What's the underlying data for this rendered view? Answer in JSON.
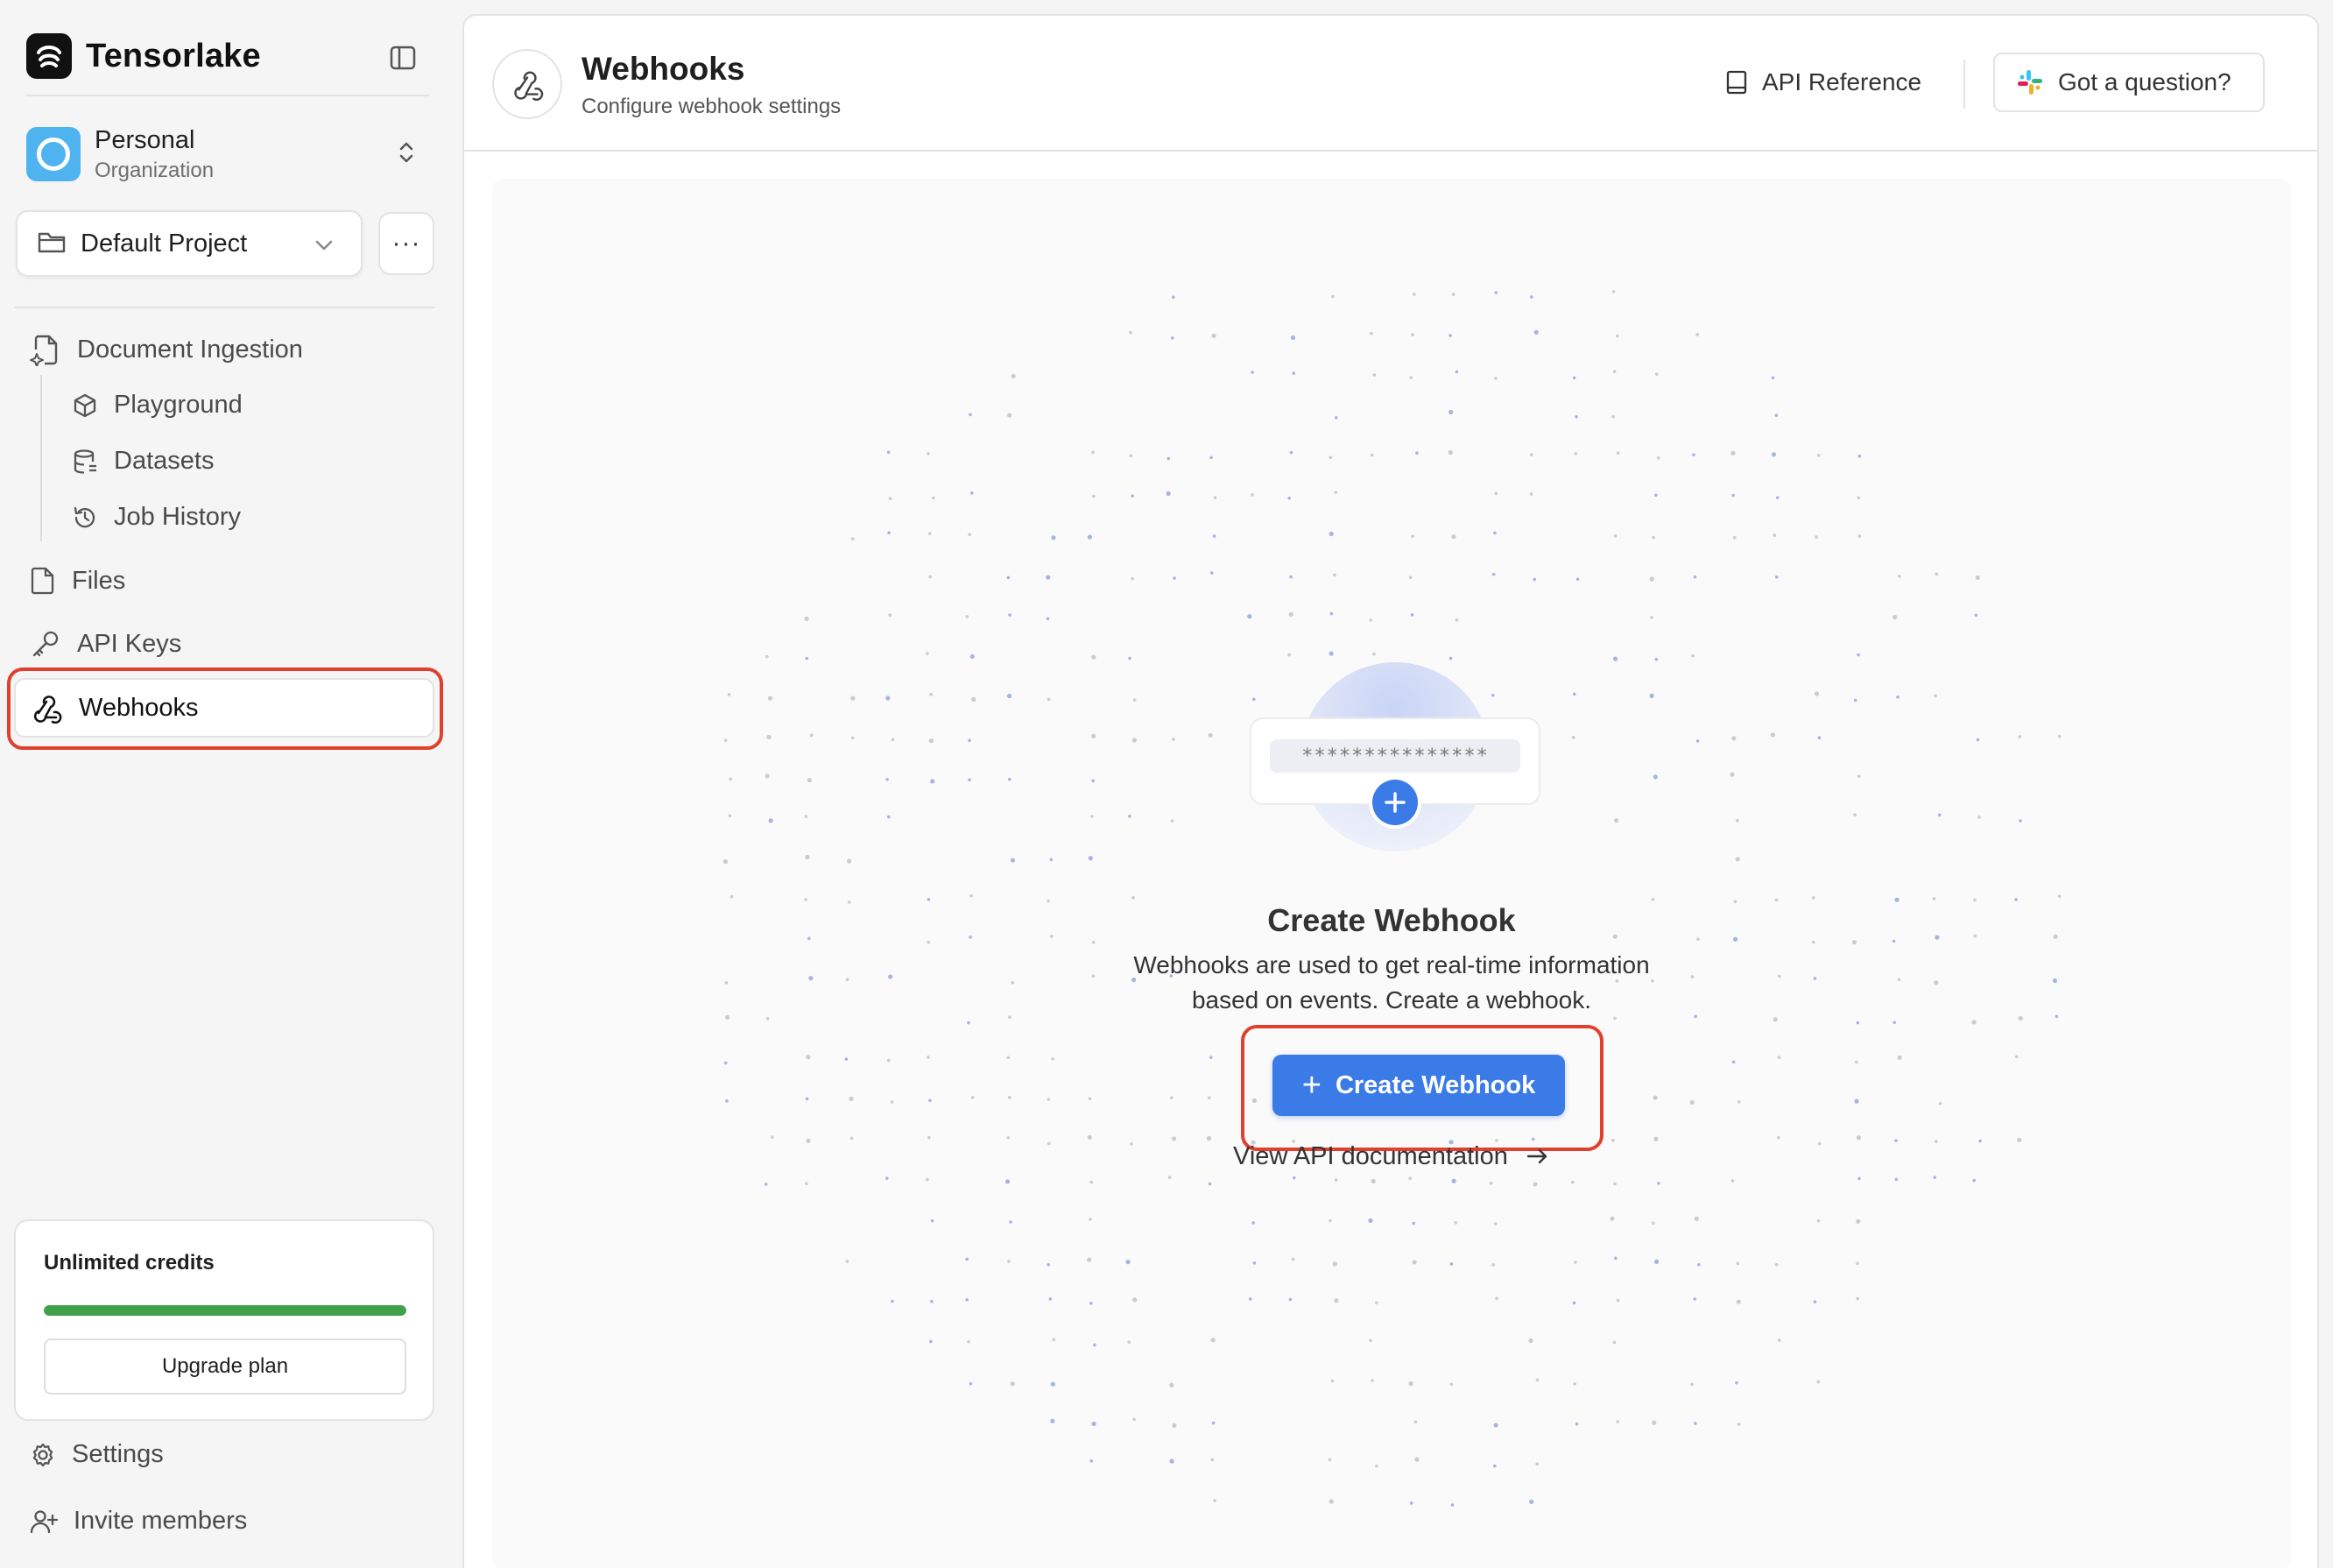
{
  "sidebar": {
    "brand": "Tensorlake",
    "org": {
      "name": "Personal",
      "subtitle": "Organization"
    },
    "project": "Default Project",
    "more_label": "···",
    "nav": {
      "document_ingestion": "Document Ingestion",
      "playground": "Playground",
      "datasets": "Datasets",
      "job_history": "Job History",
      "files": "Files",
      "api_keys": "API Keys",
      "webhooks": "Webhooks"
    },
    "credits": {
      "title": "Unlimited credits",
      "progress": 1.0,
      "upgrade_label": "Upgrade plan"
    },
    "settings": "Settings",
    "invite": "Invite members"
  },
  "header": {
    "title": "Webhooks",
    "subtitle": "Configure webhook settings",
    "api_reference": "API Reference",
    "question": "Got a question?"
  },
  "empty_state": {
    "masked_secret": "***************",
    "title": "Create Webhook",
    "description_line1": "Webhooks are used to get real-time information",
    "description_line2": "based on events. Create a webhook.",
    "button_label": "Create Webhook",
    "doc_link": "View API documentation"
  },
  "colors": {
    "accent": "#3b7be8",
    "highlight": "#e0412f",
    "credits_bar": "#3fa14a",
    "org_avatar": "#4fb3f0"
  }
}
